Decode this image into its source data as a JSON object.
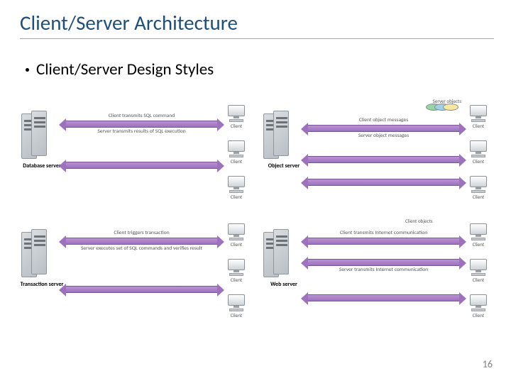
{
  "title": "Client/Server Architecture",
  "bullet": "Client/Server Design Styles",
  "page_number": "16",
  "panels": [
    {
      "server_label": "Database server",
      "top_text": "Client transmits SQL command",
      "bottom_text": "Server transmits results of SQL execution",
      "client_label": "Client",
      "objects_label": ""
    },
    {
      "server_label": "Object server",
      "top_text": "Client object messages",
      "bottom_text": "Server object messages",
      "client_label": "Client",
      "objects_label": "Server objects"
    },
    {
      "server_label": "Transaction server",
      "top_text": "Client triggers transaction",
      "bottom_text": "Server executes set of SQL commands and verifies result",
      "client_label": "Client",
      "objects_label": ""
    },
    {
      "server_label": "Web server",
      "top_text": "Client transmits Internet communication",
      "bottom_text": "Server transmits Internet communication",
      "client_label": "Client",
      "objects_label": "Client objects"
    }
  ]
}
